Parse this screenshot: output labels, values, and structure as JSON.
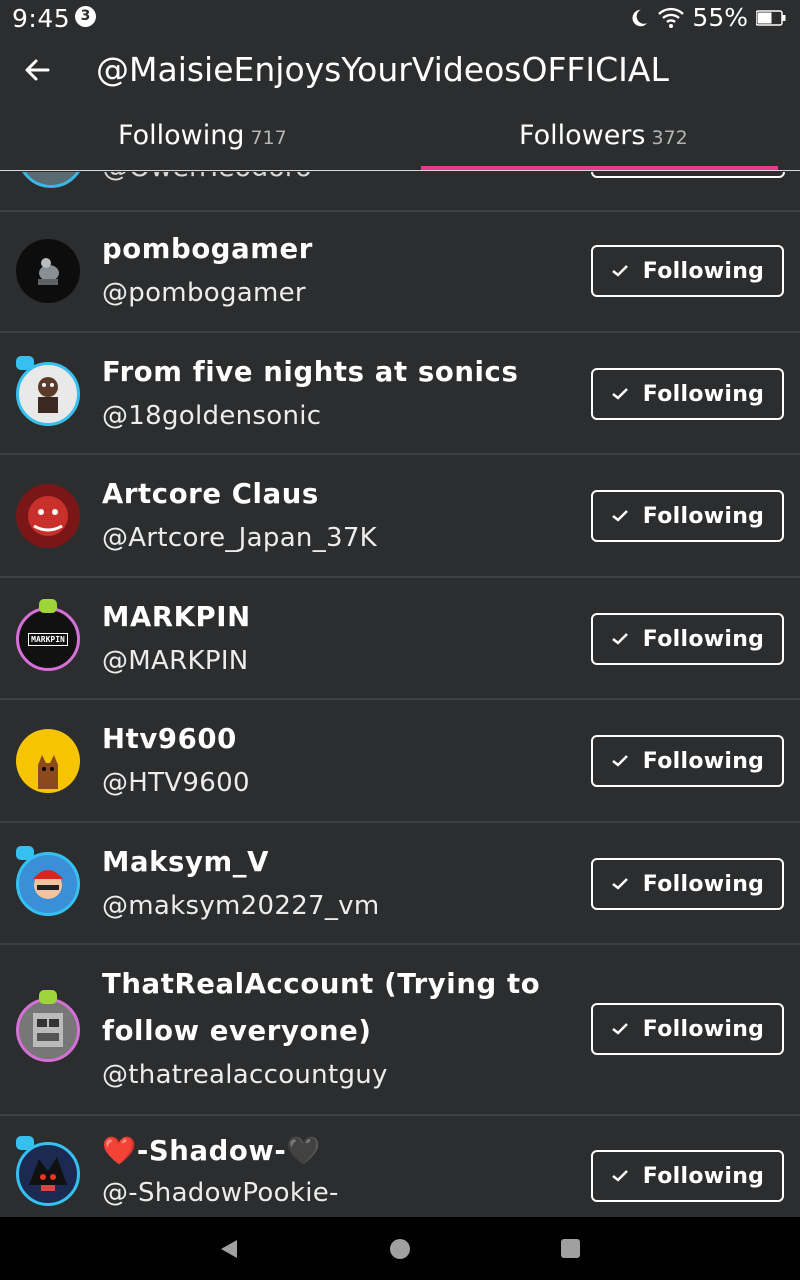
{
  "status_bar": {
    "time": "9:45",
    "notification_count": "3",
    "battery": "55%"
  },
  "header": {
    "title": "@MaisieEnjoysYourVideosOFFICIAL"
  },
  "tabs": [
    {
      "label": "Following",
      "count": "717"
    },
    {
      "label": "Followers",
      "count": "372"
    }
  ],
  "active_tab": "Followers",
  "partial_row": {
    "handle": "@OwenTeodoro"
  },
  "users": [
    {
      "name": "pombogamer",
      "handle": "@pombogamer",
      "button": "Following"
    },
    {
      "name": "From five nights at sonics",
      "handle": "@18goldensonic",
      "button": "Following"
    },
    {
      "name": "Artcore Claus",
      "handle": "@Artcore_Japan_37K",
      "button": "Following"
    },
    {
      "name": "MARKPIN",
      "handle": "@MARKPIN",
      "button": "Following",
      "avatar_text": "MARKPIN"
    },
    {
      "name": "Htv9600",
      "handle": "@HTV9600",
      "button": "Following"
    },
    {
      "name": "Maksym_V",
      "handle": "@maksym20227_vm",
      "button": "Following"
    },
    {
      "name_line1": "ThatRealAccount (Trying to",
      "name_line2": "follow everyone)",
      "handle": "@thatrealaccountguy",
      "button": "Following"
    },
    {
      "name_heart_red": "❤️",
      "name": "-Shadow-",
      "name_heart_black": "🖤",
      "handle": "@-ShadowPookie-",
      "button": "Following"
    }
  ],
  "colors": {
    "background": "#2b2d2e",
    "accent": "#e8388e",
    "divider": "#3e4143",
    "nav_bar": "#000000"
  }
}
